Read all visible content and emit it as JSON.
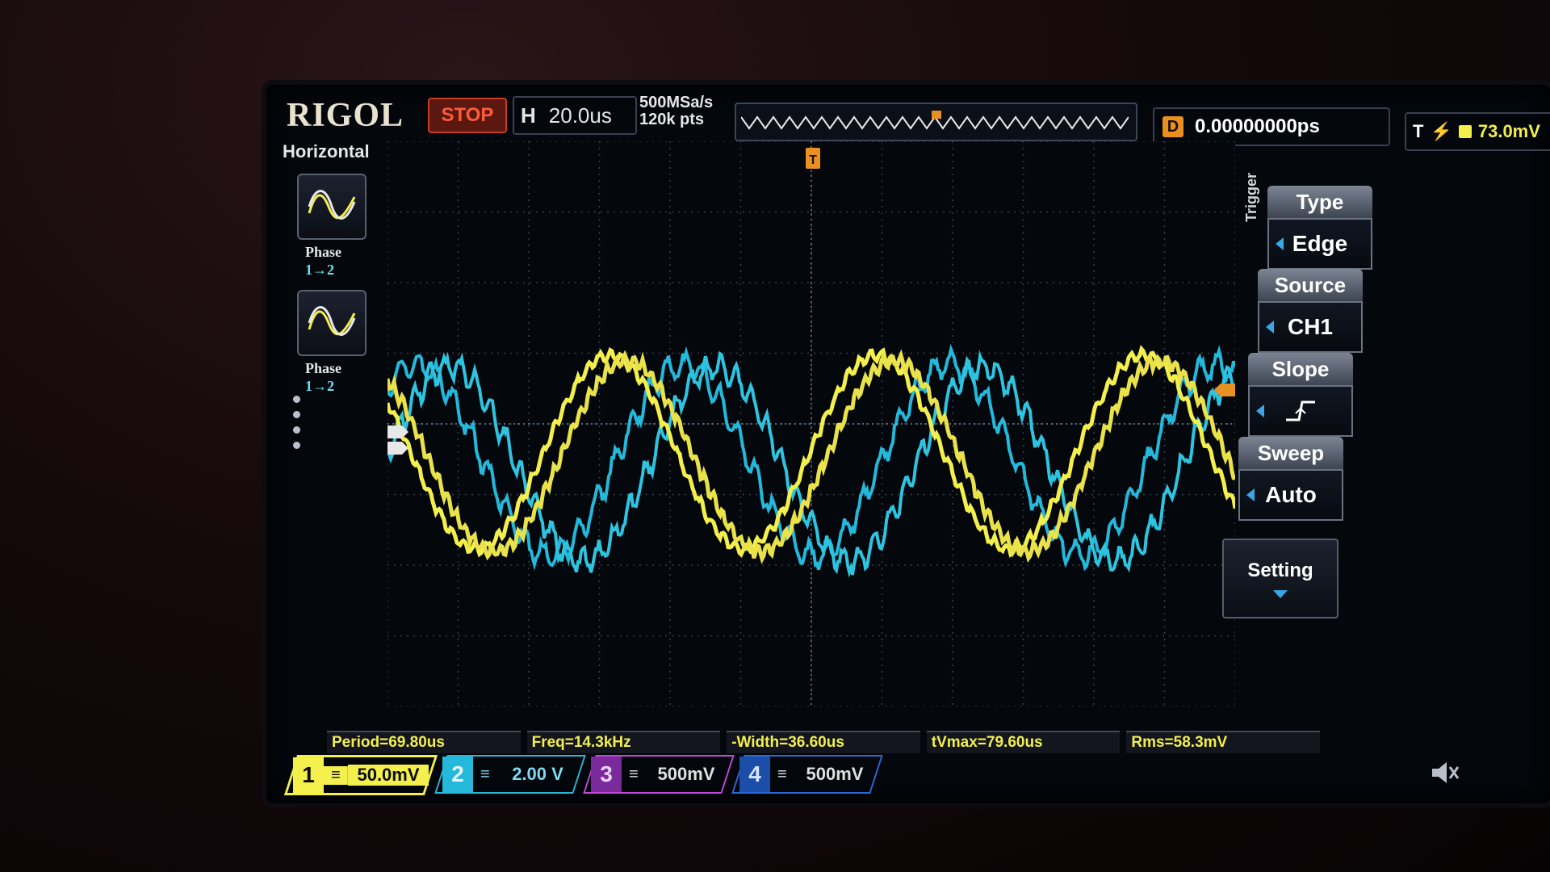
{
  "brand": "RIGOL",
  "run_state": "STOP",
  "horizontal": {
    "label": "H",
    "timebase": "20.0us"
  },
  "sample": {
    "rate": "500MSa/s",
    "points": "120k pts"
  },
  "delay": {
    "label": "D",
    "value": "0.00000000ps"
  },
  "trigger_status": {
    "label": "T",
    "level": "73.0mV"
  },
  "left_panel": {
    "title": "Horizontal",
    "buttons": [
      {
        "label": "Phase",
        "sub": "1→2",
        "icon": "waveform-icon"
      },
      {
        "label": "Phase",
        "sub": "1→2",
        "icon": "waveform-icon"
      }
    ]
  },
  "trigger_menu": {
    "title": "Trigger",
    "items": [
      {
        "header": "Type",
        "value": "Edge"
      },
      {
        "header": "Source",
        "value": "CH1"
      },
      {
        "header": "Slope",
        "value": "rising-edge-icon"
      },
      {
        "header": "Sweep",
        "value": "Auto"
      }
    ],
    "setting": "Setting"
  },
  "measurements": [
    "Period=69.80us",
    "Freq=14.3kHz",
    "-Width=36.60us",
    "tVmax=79.60us",
    "Rms=58.3mV"
  ],
  "channels": [
    {
      "num": "1",
      "coupling": "≡",
      "scale": "50.0mV",
      "color": "#f3ef4c"
    },
    {
      "num": "2",
      "coupling": "≡",
      "scale": "2.00 V",
      "color": "#24b8da"
    },
    {
      "num": "3",
      "coupling": "≡",
      "scale": "500mV",
      "color": "#c04ad8"
    },
    {
      "num": "4",
      "coupling": "≡",
      "scale": "500mV",
      "color": "#2a6ad8"
    }
  ],
  "markers": {
    "trigger_pos": "T"
  },
  "colors": {
    "ch1": "#f3ef4c",
    "ch2": "#24b8da",
    "grid": "#3c4a5c",
    "run_stop": "#ff5b3a"
  }
}
